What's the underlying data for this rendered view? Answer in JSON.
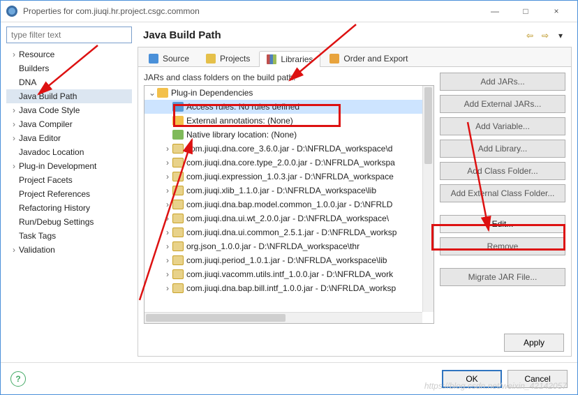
{
  "title": "Properties for com.jiuqi.hr.project.csgc.common",
  "windowButtons": {
    "min": "—",
    "max": "□",
    "close": "×"
  },
  "filterPlaceholder": "type filter text",
  "sidebar": {
    "items": [
      {
        "label": "Resource",
        "expandable": true
      },
      {
        "label": "Builders",
        "expandable": false
      },
      {
        "label": "DNA",
        "expandable": false
      },
      {
        "label": "Java Build Path",
        "expandable": false,
        "selected": true
      },
      {
        "label": "Java Code Style",
        "expandable": true
      },
      {
        "label": "Java Compiler",
        "expandable": true
      },
      {
        "label": "Java Editor",
        "expandable": true
      },
      {
        "label": "Javadoc Location",
        "expandable": false
      },
      {
        "label": "Plug-in Development",
        "expandable": true
      },
      {
        "label": "Project Facets",
        "expandable": false
      },
      {
        "label": "Project References",
        "expandable": false
      },
      {
        "label": "Refactoring History",
        "expandable": false
      },
      {
        "label": "Run/Debug Settings",
        "expandable": false
      },
      {
        "label": "Task Tags",
        "expandable": false
      },
      {
        "label": "Validation",
        "expandable": true
      }
    ]
  },
  "header": {
    "title": "Java Build Path"
  },
  "tabs": [
    {
      "label": "Source",
      "icon": "i-blue"
    },
    {
      "label": "Projects",
      "icon": "i-yellow"
    },
    {
      "label": "Libraries",
      "icon": "i-books",
      "active": true
    },
    {
      "label": "Order and Export",
      "icon": "i-order"
    }
  ],
  "jarsLabel": "JARs and class folders on the build path:",
  "libTree": {
    "root": {
      "label": "Plug-in Dependencies",
      "icon": "ic-plugin",
      "open": true
    },
    "children": [
      {
        "label": "Access rules: No rules defined",
        "icon": "ic-access",
        "selected": true,
        "leaf": true
      },
      {
        "label": "External annotations: (None)",
        "icon": "ic-ext",
        "leaf": true
      },
      {
        "label": "Native library location: (None)",
        "icon": "ic-native",
        "leaf": true
      },
      {
        "label": "com.jiuqi.dna.core_3.6.0.jar - D:\\NFRLDA_workspace\\d",
        "icon": "ic-jar"
      },
      {
        "label": "com.jiuqi.dna.core.type_2.0.0.jar - D:\\NFRLDA_workspa",
        "icon": "ic-jar"
      },
      {
        "label": "com.jiuqi.expression_1.0.3.jar - D:\\NFRLDA_workspace",
        "icon": "ic-jar"
      },
      {
        "label": "com.jiuqi.xlib_1.1.0.jar - D:\\NFRLDA_workspace\\lib",
        "icon": "ic-jar"
      },
      {
        "label": "com.jiuqi.dna.bap.model.common_1.0.0.jar - D:\\NFRLD",
        "icon": "ic-jar"
      },
      {
        "label": "com.jiuqi.dna.ui.wt_2.0.0.jar - D:\\NFRLDA_workspace\\",
        "icon": "ic-jar"
      },
      {
        "label": "com.jiuqi.dna.ui.common_2.5.1.jar - D:\\NFRLDA_worksp",
        "icon": "ic-jar"
      },
      {
        "label": "org.json_1.0.0.jar - D:\\NFRLDA_workspace\\thr",
        "icon": "ic-jar"
      },
      {
        "label": "com.jiuqi.period_1.0.1.jar - D:\\NFRLDA_workspace\\lib",
        "icon": "ic-jar"
      },
      {
        "label": "com.jiuqi.vacomm.utils.intf_1.0.0.jar - D:\\NFRLDA_work",
        "icon": "ic-jar"
      },
      {
        "label": "com.jiuqi.dna.bap.bill.intf_1.0.0.jar - D:\\NFRLDA_worksp",
        "icon": "ic-jar"
      }
    ]
  },
  "buttons": {
    "addJars": "Add JARs...",
    "addExternalJars": "Add External JARs...",
    "addVariable": "Add Variable...",
    "addLibrary": "Add Library...",
    "addClassFolder": "Add Class Folder...",
    "addExternalClassFolder": "Add External Class Folder...",
    "edit": "Edit...",
    "remove": "Remove",
    "migrate": "Migrate JAR File..."
  },
  "apply": "Apply",
  "footer": {
    "ok": "OK",
    "cancel": "Cancel"
  },
  "watermark": "https://blog.csdn.net/weixin_42142057"
}
